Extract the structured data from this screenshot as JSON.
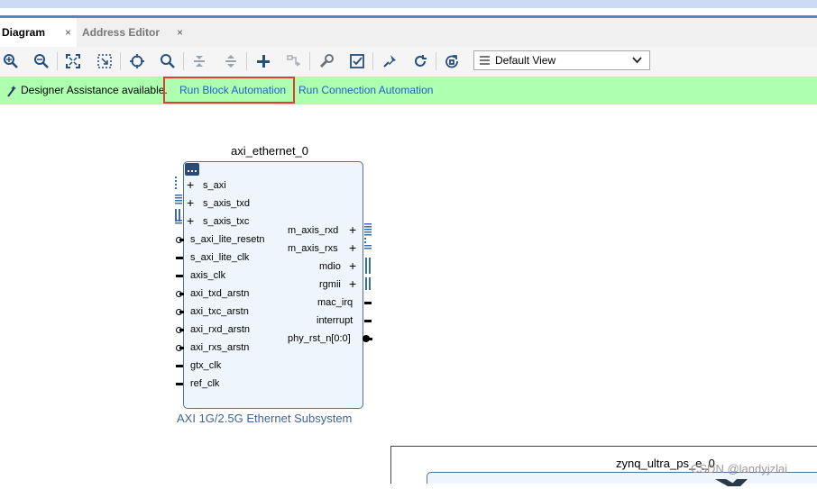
{
  "tabs": [
    {
      "label": "Diagram",
      "close": "×"
    },
    {
      "label": "Address Editor",
      "close": "×"
    }
  ],
  "toolbar": {
    "icons": [
      "zoom-in",
      "zoom-out",
      "fit",
      "zoom-selection",
      "crosshair",
      "search",
      "collapse",
      "expand",
      "add",
      "route",
      "wrench",
      "validate",
      "pin",
      "refresh",
      "regenerate"
    ],
    "view_select": "Default View"
  },
  "banner": {
    "text": "Designer Assistance available.",
    "link1": "Run Block Automation",
    "link2": "Run Connection Automation",
    "color": "#afffb0"
  },
  "ip_block": {
    "name": "axi_ethernet_0",
    "subtitle": "AXI 1G/2.5G Ethernet Subsystem",
    "left_ports": [
      "s_axi",
      "s_axis_txd",
      "s_axis_txc",
      "s_axi_lite_resetn",
      "s_axi_lite_clk",
      "axis_clk",
      "axi_txd_arstn",
      "axi_txc_arstn",
      "axi_rxd_arstn",
      "axi_rxs_arstn",
      "gtx_clk",
      "ref_clk"
    ],
    "right_ports": [
      "m_axis_rxd",
      "m_axis_rxs",
      "mdio",
      "rgmii",
      "mac_irq",
      "interrupt",
      "phy_rst_n[0:0]"
    ]
  },
  "second_block": {
    "name": "zynq_ultra_ps_e_0"
  },
  "watermark": "CSDN @landyjzlai"
}
